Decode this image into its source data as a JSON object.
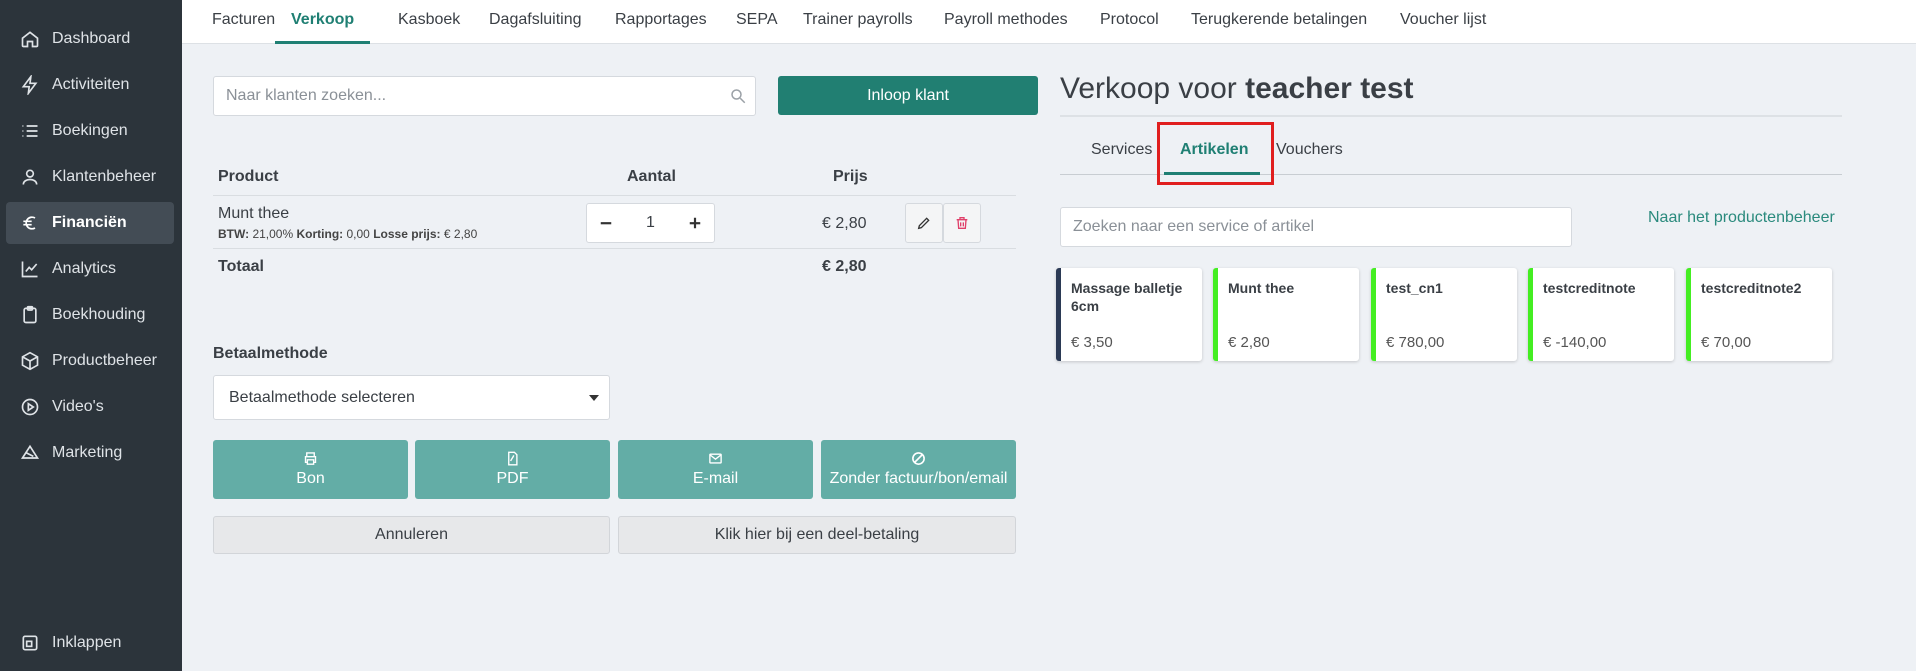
{
  "sidebar": {
    "items": [
      {
        "label": "Dashboard",
        "icon": "home-icon"
      },
      {
        "label": "Activiteiten",
        "icon": "bolt-icon"
      },
      {
        "label": "Boekingen",
        "icon": "list-icon"
      },
      {
        "label": "Klantenbeheer",
        "icon": "user-icon"
      },
      {
        "label": "Financiën",
        "icon": "euro-icon"
      },
      {
        "label": "Analytics",
        "icon": "chart-line-icon"
      },
      {
        "label": "Boekhouding",
        "icon": "clipboard-icon"
      },
      {
        "label": "Productbeheer",
        "icon": "box-icon"
      },
      {
        "label": "Video's",
        "icon": "play-circle-icon"
      },
      {
        "label": "Marketing",
        "icon": "megaphone-icon"
      }
    ],
    "collapse_label": "Inklappen"
  },
  "topnav": {
    "tabs": [
      "Facturen",
      "Verkoop",
      "Kasboek",
      "Dagafsluiting",
      "Rapportages",
      "SEPA",
      "Trainer payrolls",
      "Payroll methodes",
      "Protocol",
      "Terugkerende betalingen",
      "Voucher lijst"
    ],
    "active": "Verkoop"
  },
  "customer_search": {
    "placeholder": "Naar klanten zoeken..."
  },
  "walkin_button": "Inloop klant",
  "cart": {
    "headers": {
      "product": "Product",
      "quantity": "Aantal",
      "price": "Prijs"
    },
    "items": [
      {
        "name": "Munt thee",
        "btw_label": "BTW:",
        "btw": "21,00%",
        "discount_label": "Korting:",
        "discount": "0,00",
        "unit_label": "Losse prijs:",
        "unit": "€ 2,80",
        "quantity": "1",
        "price": "€ 2,80"
      }
    ],
    "total_label": "Totaal",
    "total": "€ 2,80"
  },
  "payment": {
    "label": "Betaalmethode",
    "selected": "Betaalmethode selecteren"
  },
  "actions": {
    "receipt": "Bon",
    "pdf": "PDF",
    "email": "E-mail",
    "none": "Zonder factuur/bon/email",
    "cancel": "Annuleren",
    "partial": "Klik hier bij een deel-betaling"
  },
  "sale": {
    "title_prefix": "Verkoop voor",
    "customer": "teacher test"
  },
  "right_tabs": {
    "tabs": [
      "Services",
      "Artikelen",
      "Vouchers"
    ],
    "active": "Artikelen"
  },
  "article_search": {
    "placeholder": "Zoeken naar een service of artikel"
  },
  "product_link": "Naar het productenbeheer",
  "products": [
    {
      "name": "Massage balletje 6cm",
      "price": "€ 3,50",
      "color": "#2b3a55"
    },
    {
      "name": "Munt thee",
      "price": "€ 2,80",
      "color": "#44ee22"
    },
    {
      "name": "test_cn1",
      "price": "€ 780,00",
      "color": "#44ee22"
    },
    {
      "name": "testcreditnote",
      "price": "€ -140,00",
      "color": "#44ee22"
    },
    {
      "name": "testcreditnote2",
      "price": "€ 70,00",
      "color": "#44ee22"
    }
  ],
  "colors": {
    "accent": "#217f72",
    "action": "#63ada6",
    "sidebar": "#2c343b",
    "highlight": "#e01e1e"
  }
}
